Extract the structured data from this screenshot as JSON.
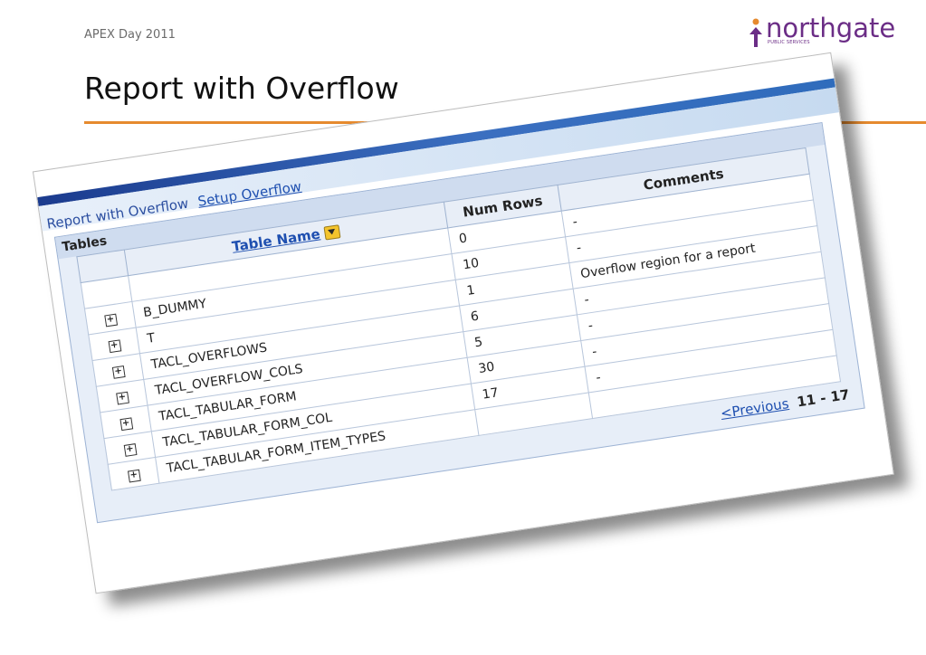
{
  "slide": {
    "header_label": "APEX Day 2011",
    "logo_text": "northgate",
    "logo_sub": "PUBLIC SERVICES",
    "title": "Report with Overflow",
    "accent_color": "#e68a2e",
    "brand_color": "#6b2d86"
  },
  "region": {
    "title": "Report with Overflow",
    "setup_link": "Setup Overflow"
  },
  "report": {
    "title": "Tables",
    "columns": [
      "Table Name",
      "Num Rows",
      "Comments"
    ],
    "rows": [
      {
        "name": "",
        "rows": "0",
        "comment": "-"
      },
      {
        "name": "B_DUMMY",
        "rows": "10",
        "comment": "-"
      },
      {
        "name": "T",
        "rows": "1",
        "comment": "Overflow region for a report"
      },
      {
        "name": "TACL_OVERFLOWS",
        "rows": "6",
        "comment": "-"
      },
      {
        "name": "TACL_OVERFLOW_COLS",
        "rows": "5",
        "comment": "-"
      },
      {
        "name": "TACL_TABULAR_FORM",
        "rows": "30",
        "comment": "-"
      },
      {
        "name": "TACL_TABULAR_FORM_COL",
        "rows": "17",
        "comment": "-"
      },
      {
        "name": "TACL_TABULAR_FORM_ITEM_TYPES",
        "rows": "",
        "comment": ""
      }
    ],
    "expand_icon": "+",
    "pagination": {
      "prev_label": "<Previous",
      "range": "11 - 17"
    }
  }
}
